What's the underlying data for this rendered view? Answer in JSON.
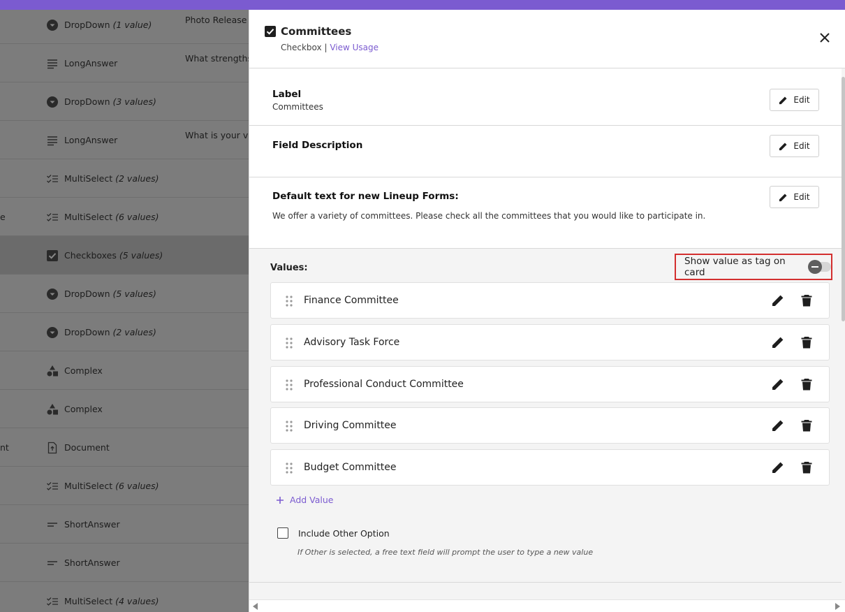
{
  "colors": {
    "accent": "#7b5bd0",
    "highlight_border": "#d32f2f"
  },
  "background_rows": [
    {
      "icon": "dropdown-icon",
      "type": "DropDown",
      "count": "(1 value)",
      "description": "Photo Release C",
      "left_text": ""
    },
    {
      "icon": "long-answer-icon",
      "type": "LongAnswer",
      "count": "",
      "description": "What strengths,",
      "left_text": ""
    },
    {
      "icon": "dropdown-icon",
      "type": "DropDown",
      "count": "(3 values)",
      "description": "",
      "left_text": ""
    },
    {
      "icon": "long-answer-icon",
      "type": "LongAnswer",
      "count": "",
      "description": "What is your vis",
      "left_text": ""
    },
    {
      "icon": "multiselect-icon",
      "type": "MultiSelect",
      "count": "(2 values)",
      "description": "",
      "left_text": ""
    },
    {
      "icon": "multiselect-icon",
      "type": "MultiSelect",
      "count": "(6 values)",
      "description": "",
      "left_text": "e"
    },
    {
      "icon": "checkbox-icon",
      "type": "Checkboxes",
      "count": "(5 values)",
      "description": "",
      "left_text": ""
    },
    {
      "icon": "dropdown-icon",
      "type": "DropDown",
      "count": "(5 values)",
      "description": "",
      "left_text": ""
    },
    {
      "icon": "dropdown-icon",
      "type": "DropDown",
      "count": "(2 values)",
      "description": "",
      "left_text": ""
    },
    {
      "icon": "complex-icon",
      "type": "Complex",
      "count": "",
      "description": "",
      "left_text": ""
    },
    {
      "icon": "complex-icon",
      "type": "Complex",
      "count": "",
      "description": "",
      "left_text": ""
    },
    {
      "icon": "document-icon",
      "type": "Document",
      "count": "",
      "description": "",
      "left_text": "nt"
    },
    {
      "icon": "multiselect-icon",
      "type": "MultiSelect",
      "count": "(6 values)",
      "description": "",
      "left_text": ""
    },
    {
      "icon": "short-answer-icon",
      "type": "ShortAnswer",
      "count": "",
      "description": "",
      "left_text": ""
    },
    {
      "icon": "short-answer-icon",
      "type": "ShortAnswer",
      "count": "",
      "description": "",
      "left_text": ""
    },
    {
      "icon": "multiselect-icon",
      "type": "MultiSelect",
      "count": "(4 values)",
      "description": "",
      "left_text": ""
    }
  ],
  "panel": {
    "title": "Committees",
    "field_type": "Checkbox",
    "separator": "|",
    "view_usage": "View Usage",
    "label_section": {
      "title": "Label",
      "value": "Committees",
      "edit": "Edit"
    },
    "description_section": {
      "title": "Field Description",
      "edit": "Edit"
    },
    "default_text_section": {
      "title": "Default text for new Lineup Forms:",
      "value": "We offer a variety of committees. Please check all the committees that you would like to participate in.",
      "edit": "Edit"
    },
    "values_label": "Values:",
    "tag_toggle_label": "Show value as tag on card",
    "tag_toggle_on": false,
    "values": [
      "Finance Committee",
      "Advisory Task Force",
      "Professional Conduct Committee",
      "Driving Committee",
      "Budget Committee"
    ],
    "add_value": "Add Value",
    "other_option_label": "Include Other Option",
    "other_option_checked": false,
    "other_option_hint": "If Other is selected, a free text field will prompt the user to type a new value"
  }
}
